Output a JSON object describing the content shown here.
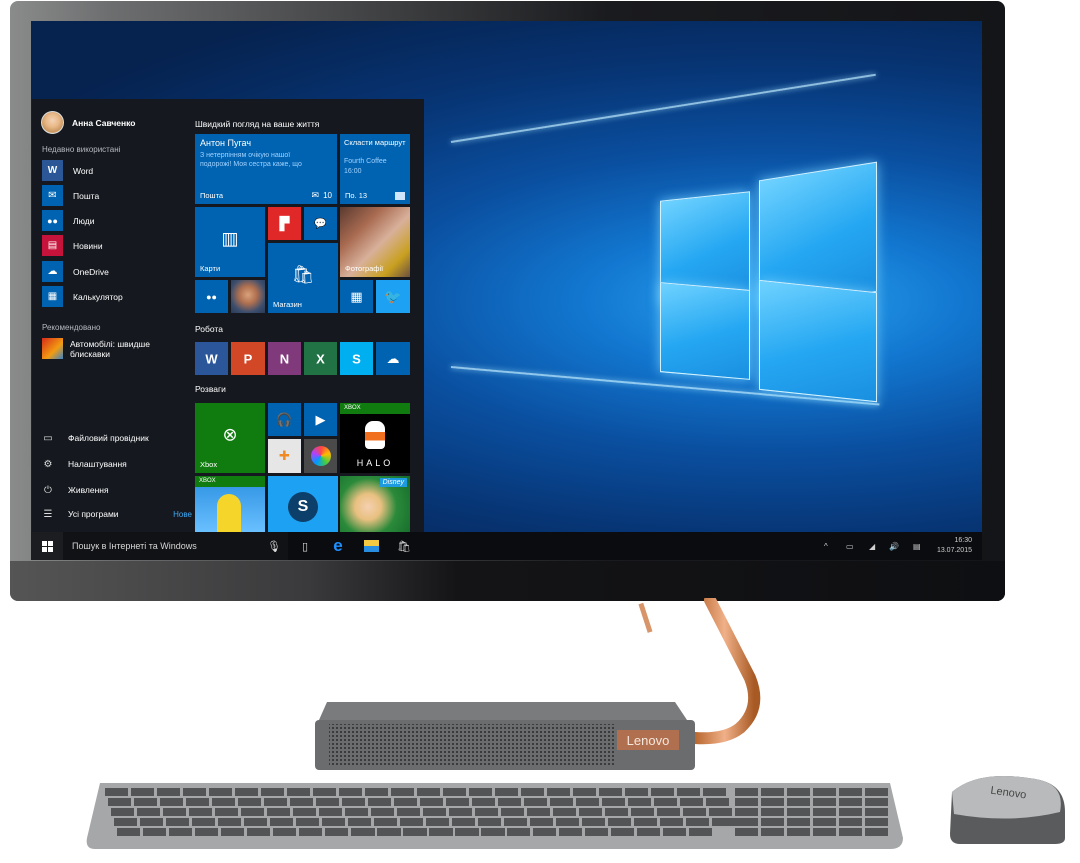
{
  "device": {
    "brand_base": "Lenovo",
    "brand_mouse": "Lenovo"
  },
  "start_menu": {
    "user_name": "Анна Савченко",
    "recent_label": "Недавно використані",
    "recent_apps": [
      {
        "label": "Word",
        "icon": "word-icon",
        "color": "#2b5797",
        "glyph": "W"
      },
      {
        "label": "Пошта",
        "icon": "mail-icon",
        "color": "#0063b1",
        "glyph": "✉"
      },
      {
        "label": "Люди",
        "icon": "people-icon",
        "color": "#0063b1",
        "glyph": "👥"
      },
      {
        "label": "Новини",
        "icon": "news-icon",
        "color": "#c6133b",
        "glyph": "▤"
      },
      {
        "label": "OneDrive",
        "icon": "onedrive-icon",
        "color": "#0063b1",
        "glyph": "☁"
      },
      {
        "label": "Калькулятор",
        "icon": "calculator-icon",
        "color": "#0063b1",
        "glyph": "▦"
      }
    ],
    "recommended_label": "Рекомендовано",
    "recommended_app": {
      "label": "Автомобілі: швидше блискавки",
      "icon": "cars-game-icon"
    },
    "system_items": [
      {
        "label": "Файловий провідник",
        "icon": "folder-icon",
        "glyph": "▭"
      },
      {
        "label": "Налаштування",
        "icon": "gear-icon",
        "glyph": "⚙"
      },
      {
        "label": "Живлення",
        "icon": "power-icon",
        "glyph": "⏻"
      },
      {
        "label": "Усі програми",
        "icon": "list-icon",
        "glyph": "☰"
      }
    ],
    "new_badge": "Нове",
    "groups": {
      "life": "Швидкий погляд на ваше життя",
      "work": "Робота",
      "play": "Розваги"
    },
    "tiles": {
      "mail": {
        "sender": "Антон Пугач",
        "preview": "З нетерпінням очікую нашої подорожі! Моя сестра каже, що",
        "label": "Пошта",
        "count": "10"
      },
      "calendar": {
        "title": "Скласти маршрут",
        "location": "Fourth Coffee",
        "time": "16:00",
        "label": "По. 13"
      },
      "maps": {
        "label": "Карти"
      },
      "photos": {
        "label": "Фотографії"
      },
      "store": {
        "label": "Магазин"
      },
      "xbox": {
        "label": "Xbox"
      },
      "xbox_badge": "XBOX",
      "halo": {
        "label": "HALO"
      },
      "disney": {
        "label": "Disney"
      }
    },
    "work_tiles": [
      {
        "name": "word",
        "color": "#2b579a",
        "glyph": "W"
      },
      {
        "name": "powerpoint",
        "color": "#d24726",
        "glyph": "P"
      },
      {
        "name": "onenote",
        "color": "#80397b",
        "glyph": "N"
      },
      {
        "name": "excel",
        "color": "#217346",
        "glyph": "X"
      },
      {
        "name": "skype",
        "color": "#00aff0",
        "glyph": "S"
      },
      {
        "name": "onedrive",
        "color": "#0063b1",
        "glyph": "☁"
      }
    ]
  },
  "taskbar": {
    "search_placeholder": "Пошук в Інтернеті та Windows",
    "time": "16:30",
    "date": "13.07.2015"
  }
}
